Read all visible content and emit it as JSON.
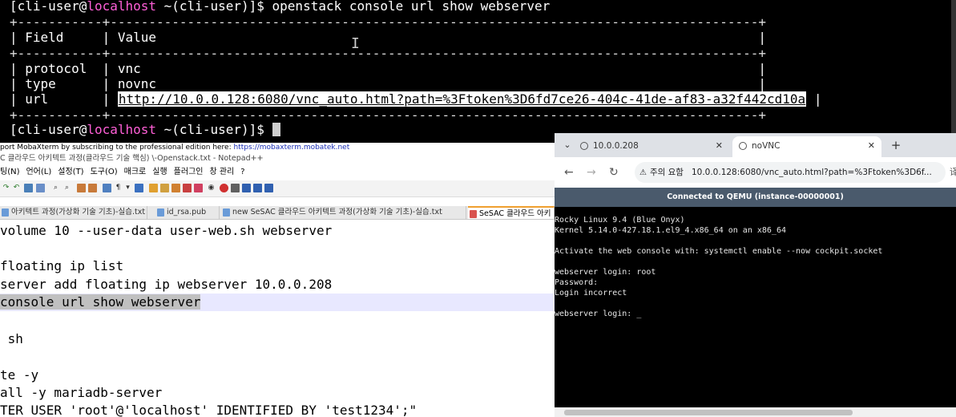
{
  "terminal": {
    "prompt_user": "[cli-user@",
    "prompt_host": "localhost",
    "prompt_path": " ~(cli-user)]$ ",
    "command": "openstack console url show webserver",
    "border": "+-----------+------------------------------------------------------------------------------------+",
    "header_row": "| Field     | Value                                                                              |",
    "row_protocol": "| protocol  | vnc                                                                                |",
    "row_type": "| type      | novnc                                                                              |",
    "row_url_prefix": "| url       | ",
    "url": "http://10.0.0.128:6080/vnc_auto.html?path=%3Ftoken%3D6fd7ce26-404c-41de-af83-a32f442cd10a",
    "row_url_suffix": " |",
    "prompt2_end": " ~(cli-user)]$ "
  },
  "mobaxterm": {
    "notice": "port MobaXterm by subscribing to the professional edition here: ",
    "link": "https://mobaxterm.mobatek.net"
  },
  "notepad": {
    "title": "C 클라우드 아키텍트 과정(클라우드 기술 핵심) \\-Openstack.txt - Notepad++",
    "menu": [
      "팅(N)",
      "언어(L)",
      "설정(T)",
      "도구(O)",
      "매크로",
      "실행",
      "플러그인",
      "창 관리",
      "?"
    ],
    "tabs": [
      {
        "label": "아키텍트 과정(가상화 기술 기초)-실습.txt"
      },
      {
        "label": "id_rsa.pub"
      },
      {
        "label": "new SeSAC 클라우드 아키텍트 과정(가상화 기술 기초)-실습.txt"
      },
      {
        "label": "SeSAC 클라우드 아키"
      }
    ],
    "lines": [
      "volume 10 --user-data user-web.sh webserver",
      "",
      "floating ip list",
      "server add floating ip webserver 10.0.0.208",
      "console url show webserver",
      "",
      " sh",
      "",
      "te -y",
      "all -y mariadb-server",
      "TER USER 'root'@'localhost' IDENTIFIED BY 'test1234';\""
    ]
  },
  "browser": {
    "tab1_title": "10.0.0.208",
    "tab2_title": "noVNC",
    "new_tab": "+",
    "security_label": "주의 요함",
    "address": "10.0.0.128:6080/vnc_auto.html?path=%3Ftoken%3D6f...",
    "status_bar": "Connected to QEMU (instance-00000001)",
    "console_lines": [
      "Rocky Linux 9.4 (Blue Onyx)",
      "Kernel 5.14.0-427.18.1.el9_4.x86_64 on an x86_64",
      "",
      "Activate the web console with: systemctl enable --now cockpit.socket",
      "",
      "webserver login: root",
      "Password:",
      "Login incorrect",
      "",
      "webserver login: _"
    ]
  },
  "colors": {
    "terminal_host": "#ff5fd7",
    "novnc_bar": "#4a5a6c"
  }
}
